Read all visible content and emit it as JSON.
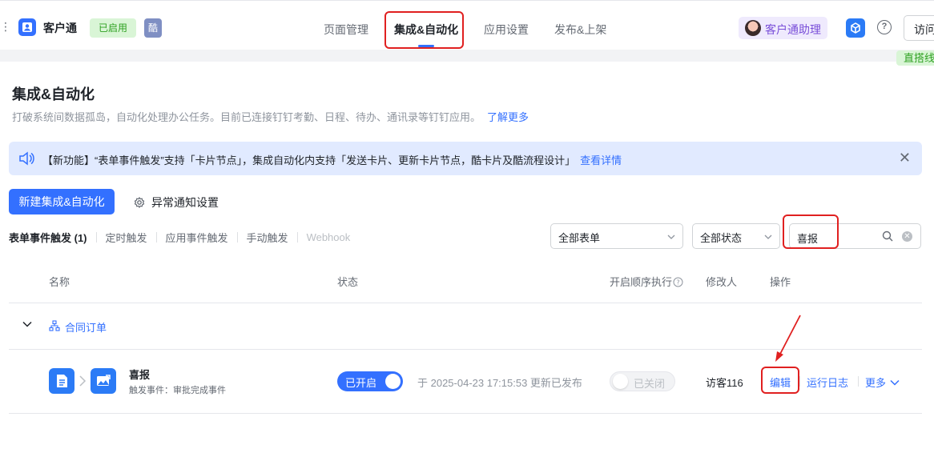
{
  "header": {
    "app_name": "客户通",
    "status_badge": "已启用",
    "ku_badge": "酷",
    "tabs": [
      {
        "label": "页面管理"
      },
      {
        "label": "集成&自动化"
      },
      {
        "label": "应用设置"
      },
      {
        "label": "发布&上架"
      }
    ],
    "assistant_label": "客户通助理",
    "help_glyph": "?",
    "visit_label": "访问",
    "zhida_label": "直搭线"
  },
  "page": {
    "title": "集成&自动化",
    "description": "打破系统间数据孤岛，自动化处理办公任务。目前已连接钉钉考勤、日程、待办、通讯录等钉钉应用。",
    "learn_more": "了解更多"
  },
  "notice": {
    "text": "【新功能】“表单事件触发”支持「卡片节点」，集成自动化内支持「发送卡片、更新卡片节点，酷卡片及酷流程设计」",
    "link": "查看详情",
    "close_glyph": "✕"
  },
  "actions": {
    "create_label": "新建集成&自动化",
    "notify_settings_label": "异常通知设置"
  },
  "trigger_tabs": [
    {
      "label": "表单事件触发 (1)"
    },
    {
      "label": "定时触发"
    },
    {
      "label": "应用事件触发"
    },
    {
      "label": "手动触发"
    },
    {
      "label": "Webhook"
    }
  ],
  "filters": {
    "form_select": "全部表单",
    "status_select": "全部状态",
    "search_value": "喜报",
    "clear_glyph": "✕"
  },
  "table": {
    "headers": {
      "name": "名称",
      "status": "状态",
      "sequential": "开启顺序执行",
      "modifier": "修改人",
      "actions": "操作"
    },
    "group": {
      "name": "合同订单"
    },
    "row": {
      "name": "喜报",
      "trigger": "触发事件：审批完成事件",
      "status_toggle": "已开启",
      "update_info": "于 2025-04-23 17:15:53 更新已发布",
      "sequential_toggle": "已关闭",
      "modifier": "访客116",
      "edit": "编辑",
      "run_log": "运行日志",
      "more": "更多"
    }
  },
  "colors": {
    "primary": "#3370ff",
    "success_bg": "#d9f5d6",
    "success_text": "#2ea121",
    "annotation_red": "#e02020"
  }
}
